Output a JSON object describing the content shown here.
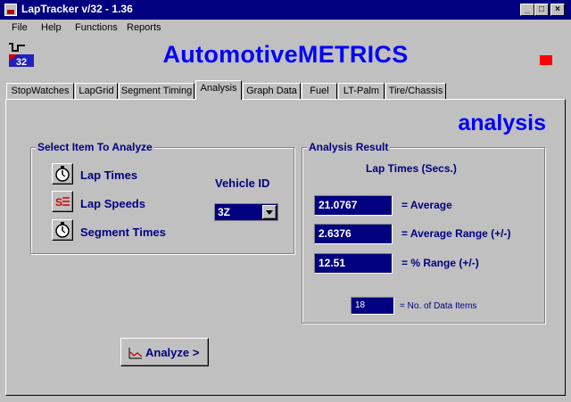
{
  "window": {
    "title": "LapTracker v/32 - 1.36"
  },
  "menu": [
    "File",
    "Help",
    "Functions",
    "Reports"
  ],
  "header": {
    "logo_text": "LT 32",
    "brand": "AutomotiveMETRICS"
  },
  "tabs": [
    "StopWatches",
    "LapGrid",
    "Segment Timing",
    "Analysis",
    "Graph Data",
    "Fuel",
    "LT-Palm",
    "Tire/Chassis"
  ],
  "active_tab": "Analysis",
  "panel": {
    "heading": "analysis"
  },
  "select_group": {
    "title": "Select Item To Analyze",
    "options": [
      {
        "label": "Lap Times",
        "icon": "stopwatch-icon"
      },
      {
        "label": "Lap Speeds",
        "icon": "speed-icon"
      },
      {
        "label": "Segment Times",
        "icon": "stopwatch-icon"
      }
    ],
    "vehicle_label": "Vehicle ID",
    "vehicle_value": "3Z"
  },
  "result_group": {
    "title": "Analysis Result",
    "subtitle": "Lap Times (Secs.)",
    "rows": [
      {
        "value": "21.0767",
        "label": "= Average"
      },
      {
        "value": "2.6376",
        "label": "= Average Range (+/-)"
      },
      {
        "value": "12.51",
        "label": "= % Range (+/-)"
      }
    ],
    "count_value": "18",
    "count_label": "= No. of Data Items"
  },
  "analyze_button": "Analyze >",
  "colors": {
    "brand": "#0000ff",
    "titlebar": "#000080",
    "field": "#000080",
    "accent_red": "#ff0000"
  }
}
